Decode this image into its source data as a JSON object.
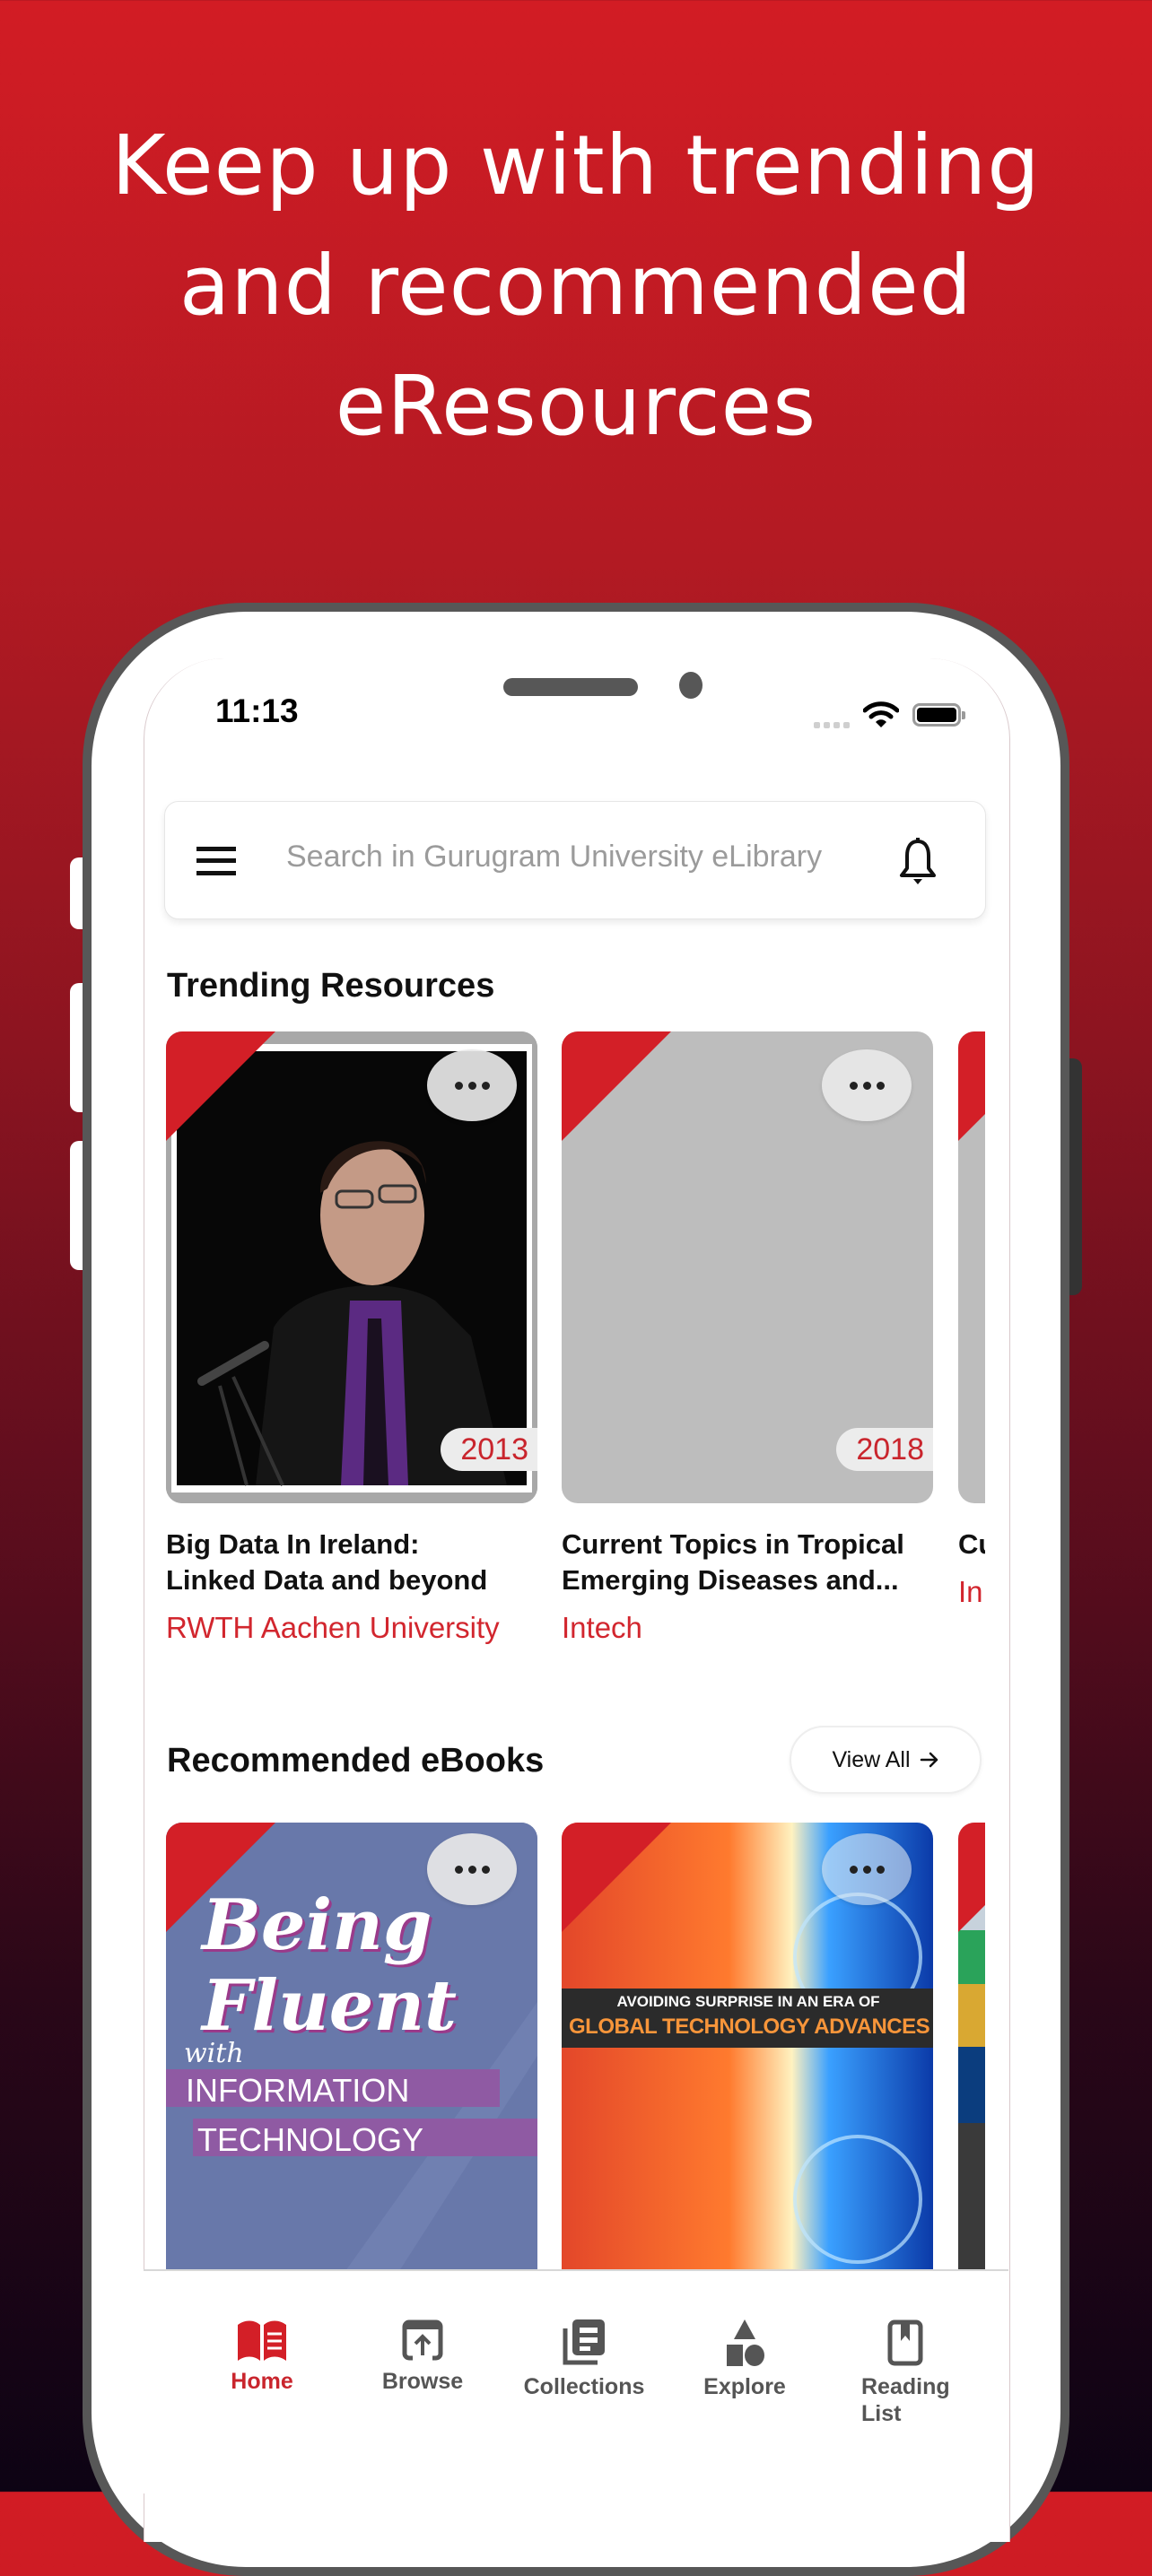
{
  "headline": {
    "lines": [
      "Keep up with trending",
      "and recommended",
      "eResources"
    ]
  },
  "status_bar": {
    "time": "11:13"
  },
  "search": {
    "placeholder": "Search in Gurugram University eLibrary"
  },
  "trending": {
    "title": "Trending Resources",
    "items": [
      {
        "title_line1": "Big Data In Ireland:",
        "title_line2": "Linked Data and beyond",
        "publisher": "RWTH Aachen University",
        "year": "2013",
        "thumbnail": "speaker-photo"
      },
      {
        "title_line1": "Current Topics in Tropical",
        "title_line2": "Emerging Diseases and...",
        "publisher": "Intech",
        "year": "2018",
        "thumbnail": "placeholder-gray"
      },
      {
        "title_line1": "Cu",
        "title_line2": "",
        "publisher": "In",
        "year": "",
        "thumbnail": "placeholder-gray"
      }
    ]
  },
  "recommended": {
    "title": "Recommended eBooks",
    "view_all_label": "View All",
    "items": [
      {
        "cover_title": "Being Fluent",
        "cover_with": "with",
        "cover_sub1": "INFORMATION",
        "cover_sub2": "TECHNOLOGY"
      },
      {
        "cover_line1": "AVOIDING SURPRISE IN AN ERA OF",
        "cover_line2": "GLOBAL TECHNOLOGY ADVANCES"
      },
      {
        "cover_title": ""
      }
    ]
  },
  "bottom_nav": {
    "items": [
      {
        "label": "Home",
        "icon": "open-book-icon",
        "active": true
      },
      {
        "label": "Browse",
        "icon": "browse-upload-icon",
        "active": false
      },
      {
        "label": "Collections",
        "icon": "collections-icon",
        "active": false
      },
      {
        "label": "Explore",
        "icon": "shapes-icon",
        "active": false
      },
      {
        "label": "Reading List",
        "icon": "bookmark-icon",
        "active": false
      }
    ]
  },
  "colors": {
    "brand_red": "#d31f27",
    "accent_text_red": "#c9252d",
    "inactive_nav": "#555555"
  }
}
